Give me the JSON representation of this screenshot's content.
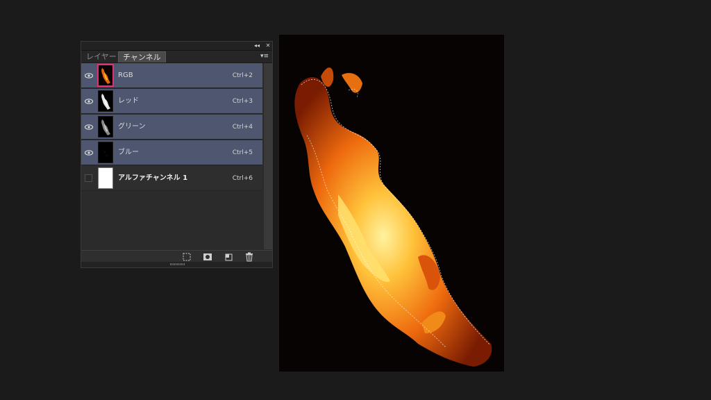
{
  "panel": {
    "collapse_icon": "◂◂",
    "close_icon": "✕",
    "menu_icon": "▾≡",
    "tabs": [
      {
        "label": "レイヤー",
        "active": false
      },
      {
        "label": "チャンネル",
        "active": true
      }
    ],
    "channels": [
      {
        "label": "RGB",
        "shortcut": "Ctrl+2",
        "visible": true,
        "selected": true
      },
      {
        "label": "レッド",
        "shortcut": "Ctrl+3",
        "visible": true,
        "selected": true
      },
      {
        "label": "グリーン",
        "shortcut": "Ctrl+4",
        "visible": true,
        "selected": true
      },
      {
        "label": "ブルー",
        "shortcut": "Ctrl+5",
        "visible": true,
        "selected": true
      },
      {
        "label": "アルファチャンネル 1",
        "shortcut": "Ctrl+6",
        "visible": false,
        "selected": false
      }
    ],
    "bottom_buttons": [
      {
        "name": "load-selection-icon",
        "glyph": "⬚"
      },
      {
        "name": "save-selection-icon",
        "glyph": "◙"
      },
      {
        "name": "new-channel-icon",
        "glyph": "◰"
      },
      {
        "name": "delete-channel-icon",
        "glyph": "🗑"
      }
    ]
  },
  "colors": {
    "selected_row": "#4e5670",
    "highlight": "#e0307a",
    "fire_core": "#ffd24a",
    "fire_outer": "#e8660c"
  }
}
